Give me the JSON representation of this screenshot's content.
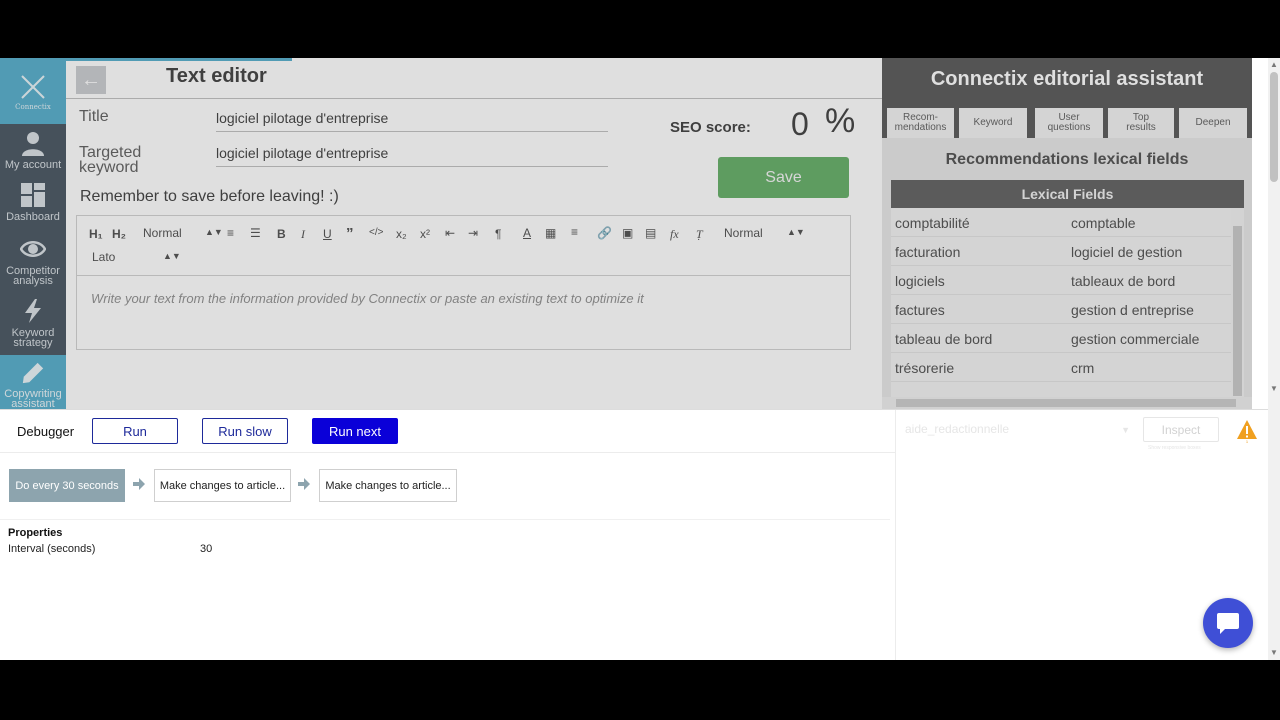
{
  "sidebar": {
    "logo_text": "Connectix",
    "items": [
      {
        "label": "My account",
        "icon": "user-icon"
      },
      {
        "label": "Dashboard",
        "icon": "dashboard-icon"
      },
      {
        "label": "Competitor analysis",
        "icon": "eye-icon"
      },
      {
        "label": "Keyword strategy",
        "icon": "lightning-icon"
      },
      {
        "label": "Copywriting assistant",
        "icon": "pencil-icon",
        "active": true
      }
    ]
  },
  "editor": {
    "title": "Text editor",
    "title_label": "Title",
    "title_value": "logiciel pilotage d'entreprise",
    "keyword_label": "Targeted keyword",
    "keyword_value": "logiciel pilotage d'entreprise",
    "seo_label": "SEO score:",
    "seo_value": "0",
    "seo_unit": "%",
    "save_label": "Save",
    "reminder": "Remember to save before leaving! :)",
    "toolbar": {
      "h1": "H₁",
      "h2": "H₂",
      "size_select": "Normal",
      "size_select2": "Normal",
      "font_select": "Lato"
    },
    "placeholder": "Write your text from the information provided by Connectix or paste an existing text to optimize it"
  },
  "assistant": {
    "title": "Connectix editorial assistant",
    "tabs": [
      "Recom-\nmendations",
      "Keyword",
      "User\nquestions",
      "Top\nresults",
      "Deepen"
    ],
    "section_title": "Recommendations lexical fields",
    "table_header": "Lexical Fields",
    "rows": [
      [
        "comptabilité",
        "comptable"
      ],
      [
        "facturation",
        "logiciel de gestion"
      ],
      [
        "logiciels",
        "tableaux de bord"
      ],
      [
        "factures",
        "gestion d entreprise"
      ],
      [
        "tableau de bord",
        "gestion commerciale"
      ],
      [
        "trésorerie",
        "crm"
      ]
    ]
  },
  "debugger": {
    "title": "Debugger",
    "run_label": "Run",
    "run_slow_label": "Run slow",
    "run_next_label": "Run next",
    "select_value": "aide_redactionnelle",
    "inspect_label": "Inspect",
    "inspect_sub": "Show responsive boxes",
    "flow": [
      "Do every 30 seconds",
      "Make changes to article...",
      "Make changes to article..."
    ],
    "properties_title": "Properties",
    "properties": [
      {
        "key": "Interval (seconds)",
        "value": "30"
      }
    ]
  },
  "colors": {
    "accent": "#4aa8c8",
    "sidebar": "#3b4a57",
    "save": "#5aaa5d",
    "run_next": "#0a00d8",
    "warning": "#f0a020",
    "chat": "#3f4fd6"
  }
}
